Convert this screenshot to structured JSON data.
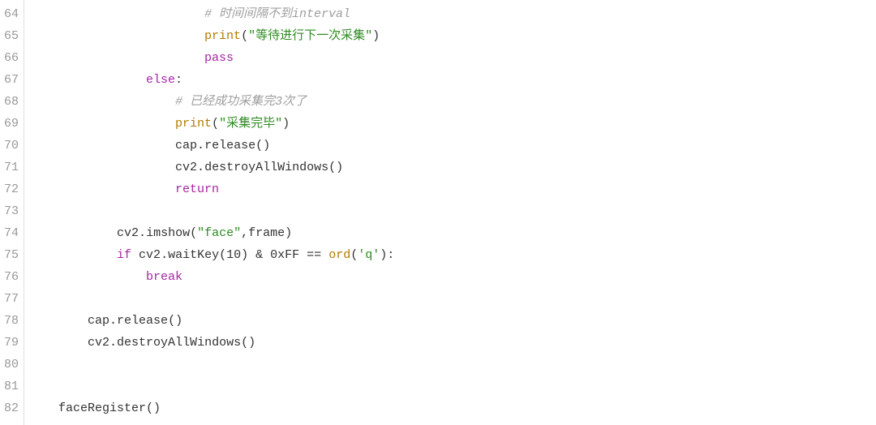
{
  "editor": {
    "startLine": 64,
    "lines": [
      {
        "indent": 24,
        "tokens": [
          {
            "cls": "tok-comment",
            "t": "# 时间间隔不到interval"
          }
        ]
      },
      {
        "indent": 24,
        "tokens": [
          {
            "cls": "tok-builtin",
            "t": "print"
          },
          {
            "cls": "tok-punct",
            "t": "("
          },
          {
            "cls": "tok-string",
            "t": "\"等待进行下一次采集\""
          },
          {
            "cls": "tok-punct",
            "t": ")"
          }
        ]
      },
      {
        "indent": 24,
        "tokens": [
          {
            "cls": "tok-keyword",
            "t": "pass"
          }
        ]
      },
      {
        "indent": 16,
        "tokens": [
          {
            "cls": "tok-keyword",
            "t": "else"
          },
          {
            "cls": "tok-punct",
            "t": ":"
          }
        ]
      },
      {
        "indent": 20,
        "tokens": [
          {
            "cls": "tok-comment",
            "t": "# 已经成功采集完3次了"
          }
        ]
      },
      {
        "indent": 20,
        "tokens": [
          {
            "cls": "tok-builtin",
            "t": "print"
          },
          {
            "cls": "tok-punct",
            "t": "("
          },
          {
            "cls": "tok-string",
            "t": "\"采集完毕\""
          },
          {
            "cls": "tok-punct",
            "t": ")"
          }
        ]
      },
      {
        "indent": 20,
        "tokens": [
          {
            "cls": "tok-ident",
            "t": "cap"
          },
          {
            "cls": "tok-punct",
            "t": "."
          },
          {
            "cls": "tok-func",
            "t": "release"
          },
          {
            "cls": "tok-punct",
            "t": "()"
          }
        ]
      },
      {
        "indent": 20,
        "tokens": [
          {
            "cls": "tok-ident",
            "t": "cv2"
          },
          {
            "cls": "tok-punct",
            "t": "."
          },
          {
            "cls": "tok-func",
            "t": "destroyAllWindows"
          },
          {
            "cls": "tok-punct",
            "t": "()"
          }
        ]
      },
      {
        "indent": 20,
        "tokens": [
          {
            "cls": "tok-keyword",
            "t": "return"
          }
        ]
      },
      {
        "indent": 0,
        "tokens": []
      },
      {
        "indent": 12,
        "tokens": [
          {
            "cls": "tok-ident",
            "t": "cv2"
          },
          {
            "cls": "tok-punct",
            "t": "."
          },
          {
            "cls": "tok-func",
            "t": "imshow"
          },
          {
            "cls": "tok-punct",
            "t": "("
          },
          {
            "cls": "tok-string",
            "t": "\"face\""
          },
          {
            "cls": "tok-punct",
            "t": ","
          },
          {
            "cls": "tok-ident",
            "t": "frame"
          },
          {
            "cls": "tok-punct",
            "t": ")"
          }
        ]
      },
      {
        "indent": 12,
        "tokens": [
          {
            "cls": "tok-keyword",
            "t": "if"
          },
          {
            "cls": "tok-ident",
            "t": " cv2"
          },
          {
            "cls": "tok-punct",
            "t": "."
          },
          {
            "cls": "tok-func",
            "t": "waitKey"
          },
          {
            "cls": "tok-punct",
            "t": "("
          },
          {
            "cls": "tok-number",
            "t": "10"
          },
          {
            "cls": "tok-punct",
            "t": ")"
          },
          {
            "cls": "tok-operator",
            "t": " & "
          },
          {
            "cls": "tok-number",
            "t": "0xFF"
          },
          {
            "cls": "tok-operator",
            "t": " == "
          },
          {
            "cls": "tok-builtin",
            "t": "ord"
          },
          {
            "cls": "tok-punct",
            "t": "("
          },
          {
            "cls": "tok-string",
            "t": "'q'"
          },
          {
            "cls": "tok-punct",
            "t": "):"
          }
        ]
      },
      {
        "indent": 16,
        "tokens": [
          {
            "cls": "tok-keyword",
            "t": "break"
          }
        ]
      },
      {
        "indent": 0,
        "tokens": []
      },
      {
        "indent": 8,
        "tokens": [
          {
            "cls": "tok-ident",
            "t": "cap"
          },
          {
            "cls": "tok-punct",
            "t": "."
          },
          {
            "cls": "tok-func",
            "t": "release"
          },
          {
            "cls": "tok-punct",
            "t": "()"
          }
        ]
      },
      {
        "indent": 8,
        "tokens": [
          {
            "cls": "tok-ident",
            "t": "cv2"
          },
          {
            "cls": "tok-punct",
            "t": "."
          },
          {
            "cls": "tok-func",
            "t": "destroyAllWindows"
          },
          {
            "cls": "tok-punct",
            "t": "()"
          }
        ]
      },
      {
        "indent": 0,
        "tokens": []
      },
      {
        "indent": 0,
        "tokens": []
      },
      {
        "indent": 4,
        "tokens": [
          {
            "cls": "tok-ident",
            "t": "faceRegister"
          },
          {
            "cls": "tok-punct",
            "t": "()"
          }
        ]
      }
    ]
  }
}
